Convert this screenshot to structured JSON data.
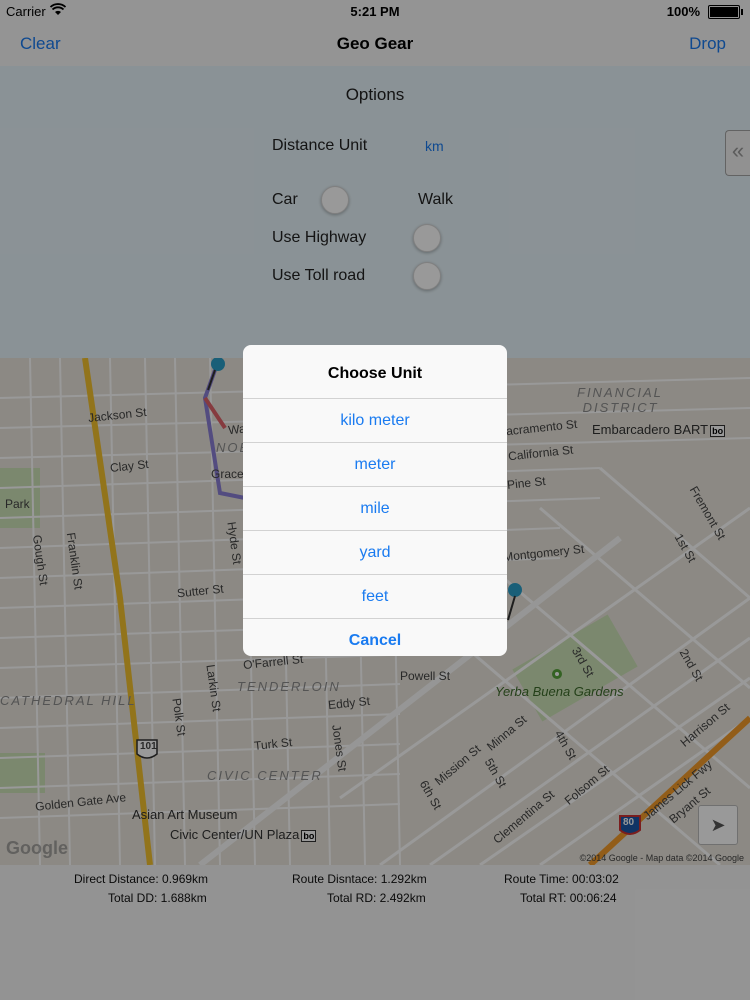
{
  "status_bar": {
    "carrier": "Carrier",
    "time": "5:21 PM",
    "battery": "100%",
    "battery_level": 1.0
  },
  "navbar": {
    "left_button": "Clear",
    "title": "Geo Gear",
    "right_button": "Drop"
  },
  "options": {
    "heading": "Options",
    "distance_unit_label": "Distance Unit",
    "distance_unit_value": "km",
    "car_label": "Car",
    "walk_label": "Walk",
    "use_highway_label": "Use Highway",
    "use_toll_label": "Use Toll road",
    "side_tab_icon": "double-chevron-left-icon"
  },
  "map": {
    "streets": [
      "Jackson St",
      "Clay St",
      "Gough St",
      "Franklin St",
      "Hyde St",
      "Sutter St",
      "Larkin St",
      "Polk St",
      "O'Farrell St",
      "Eddy St",
      "Turk St",
      "Golden Gate Ave",
      "Jones St",
      "Sacramento St",
      "California St",
      "Pine St",
      "Montgomery St",
      "Fremont St",
      "1st St",
      "Powell St",
      "Mission St",
      "Minna St",
      "5th St",
      "4th St",
      "Folsom St",
      "3rd St",
      "2nd St",
      "Harrison St",
      "Bryant St",
      "Clementina St",
      "6th St",
      "James Lick Fwy",
      "Washington",
      "Grace"
    ],
    "districts": [
      "FINANCIAL DISTRICT",
      "TENDERLOIN",
      "CIVIC CENTER",
      "CATHEDRAL HILL",
      "NOB"
    ],
    "places": [
      "Embarcadero BART",
      "Yerba Buena Gardens",
      "Asian Art Museum",
      "Civic Center/UN Plaza",
      "Park"
    ],
    "route_shields": [
      "101",
      "80"
    ],
    "bart_badge": "bo",
    "logo": "Google",
    "copyright": "©2014 Google - Map data ©2014 Google"
  },
  "stats": {
    "direct_distance": "Direct Distance: 0.969km",
    "route_distance": "Route Disntace: 1.292km",
    "route_time": "Route Time: 00:03:02",
    "total_dd": "Total DD: 1.688km",
    "total_rd": "Total RD: 2.492km",
    "total_rt": "Total RT: 00:06:24"
  },
  "dialog": {
    "title": "Choose Unit",
    "options": [
      "kilo meter",
      "meter",
      "mile",
      "yard",
      "feet"
    ],
    "cancel": "Cancel"
  }
}
